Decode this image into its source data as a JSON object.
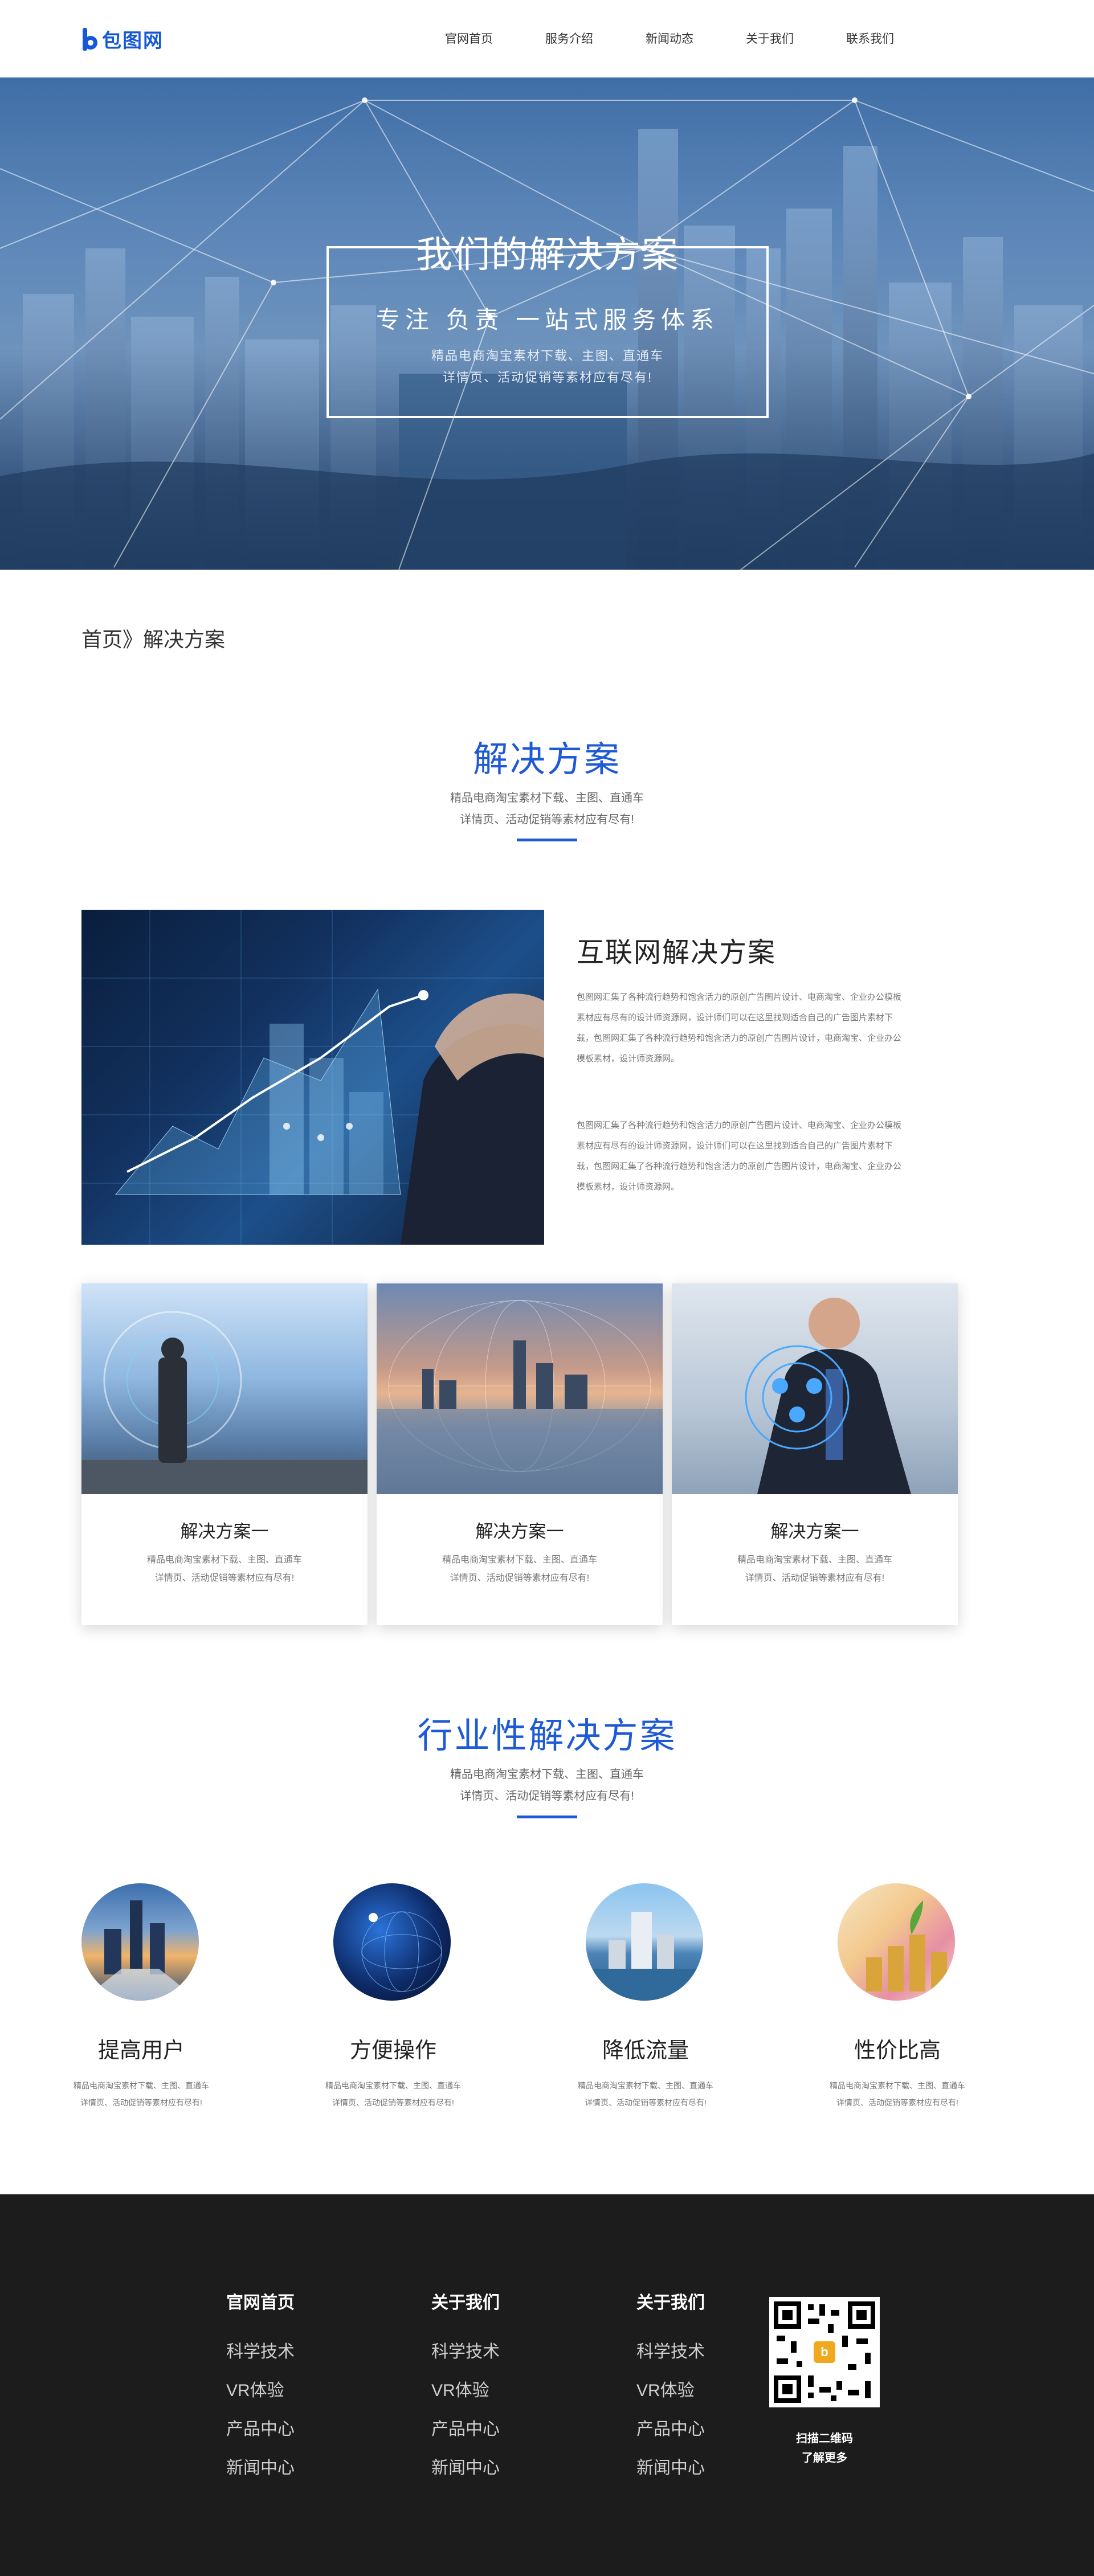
{
  "header": {
    "logo_text": "包图网",
    "nav": [
      "官网首页",
      "服务介绍",
      "新闻动态",
      "关于我们",
      "联系我们"
    ]
  },
  "hero": {
    "title": "我们的解决方案",
    "subtitle": "专注 负责 一站式服务体系",
    "desc_line1": "精品电商淘宝素材下载、主图、直通车",
    "desc_line2": "详情页、活动促销等素材应有尽有!"
  },
  "breadcrumb": {
    "home": "首页",
    "sep": "》",
    "current": "解决方案"
  },
  "solutions": {
    "title": "解决方案",
    "desc_line1": "精品电商淘宝素材下载、主图、直通车",
    "desc_line2": "详情页、活动促销等素材应有尽有!"
  },
  "feature": {
    "title": "互联网解决方案",
    "para1": "包图网汇集了各种流行趋势和饱含活力的原创广告图片设计、电商淘宝、企业办公模板素材应有尽有的设计师资源网，设计师们可以在这里找到适合自己的广告图片素材下载，包图网汇集了各种流行趋势和饱含活力的原创广告图片设计，电商淘宝、企业办公模板素材，设计师资源网。",
    "para2": "包图网汇集了各种流行趋势和饱含活力的原创广告图片设计、电商淘宝、企业办公模板素材应有尽有的设计师资源网，设计师们可以在这里找到适合自己的广告图片素材下载，包图网汇集了各种流行趋势和饱含活力的原创广告图片设计，电商淘宝、企业办公模板素材，设计师资源网。"
  },
  "cards": [
    {
      "title": "解决方案一",
      "desc_line1": "精品电商淘宝素材下载、主图、直通车",
      "desc_line2": "详情页、活动促销等素材应有尽有!"
    },
    {
      "title": "解决方案一",
      "desc_line1": "精品电商淘宝素材下载、主图、直通车",
      "desc_line2": "详情页、活动促销等素材应有尽有!"
    },
    {
      "title": "解决方案一",
      "desc_line1": "精品电商淘宝素材下载、主图、直通车",
      "desc_line2": "详情页、活动促销等素材应有尽有!"
    }
  ],
  "industry": {
    "title": "行业性解决方案",
    "desc_line1": "精品电商淘宝素材下载、主图、直通车",
    "desc_line2": "详情页、活动促销等素材应有尽有!"
  },
  "benefits": [
    {
      "title": "提高用户",
      "desc_line1": "精品电商淘宝素材下载、主图、直通车",
      "desc_line2": "详情页、活动促销等素材应有尽有!"
    },
    {
      "title": "方便操作",
      "desc_line1": "精品电商淘宝素材下载、主图、直通车",
      "desc_line2": "详情页、活动促销等素材应有尽有!"
    },
    {
      "title": "降低流量",
      "desc_line1": "精品电商淘宝素材下载、主图、直通车",
      "desc_line2": "详情页、活动促销等素材应有尽有!"
    },
    {
      "title": "性价比高",
      "desc_line1": "精品电商淘宝素材下载、主图、直通车",
      "desc_line2": "详情页、活动促销等素材应有尽有!"
    }
  ],
  "footer": {
    "columns": [
      {
        "title": "官网首页",
        "items": [
          "科学技术",
          "VR体验",
          "产品中心",
          "新闻中心"
        ]
      },
      {
        "title": "关于我们",
        "items": [
          "科学技术",
          "VR体验",
          "产品中心",
          "新闻中心"
        ]
      },
      {
        "title": "关于我们",
        "items": [
          "科学技术",
          "VR体验",
          "产品中心",
          "新闻中心"
        ]
      }
    ],
    "qr_caption_line1": "扫描二维码",
    "qr_caption_line2": "了解更多"
  },
  "colors": {
    "brand": "#1f5ad6",
    "footer_bg": "#1c1c1d"
  }
}
